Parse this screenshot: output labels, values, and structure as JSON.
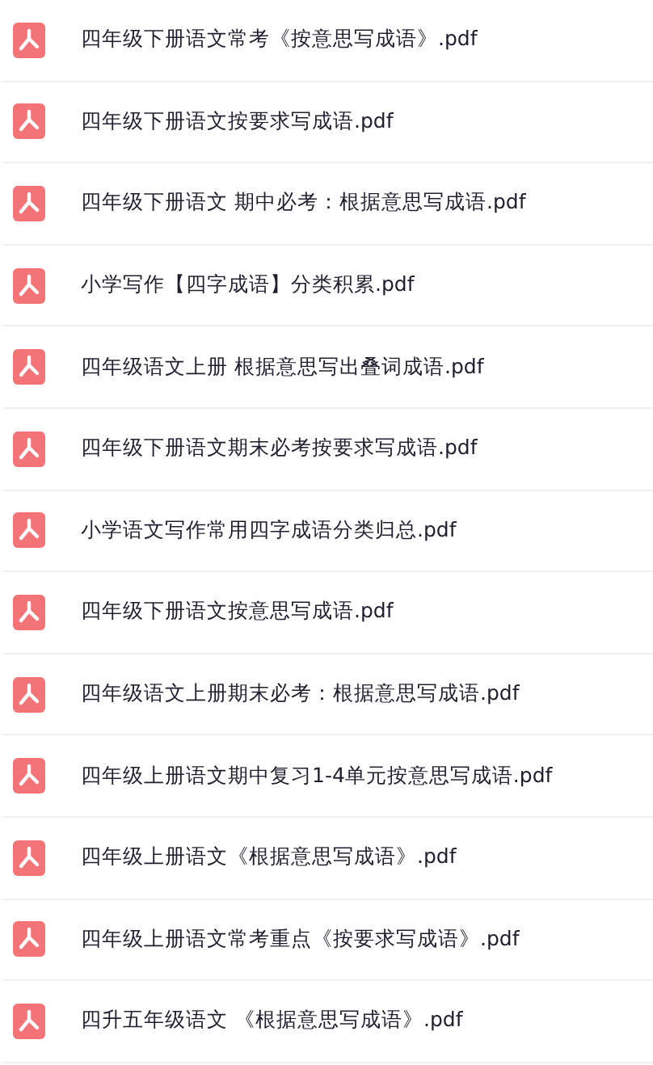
{
  "files": [
    {
      "name": "四年级下册语文常考《按意思写成语》.pdf",
      "kind": "pdf"
    },
    {
      "name": "四年级下册语文按要求写成语.pdf",
      "kind": "pdf"
    },
    {
      "name": "四年级下册语文 期中必考：根据意思写成语.pdf",
      "kind": "pdf"
    },
    {
      "name": "小学写作【四字成语】分类积累.pdf",
      "kind": "pdf"
    },
    {
      "name": "四年级语文上册 根据意思写出叠词成语.pdf",
      "kind": "pdf"
    },
    {
      "name": "四年级下册语文期末必考按要求写成语.pdf",
      "kind": "pdf"
    },
    {
      "name": "小学语文写作常用四字成语分类归总.pdf",
      "kind": "pdf"
    },
    {
      "name": "四年级下册语文按意思写成语.pdf",
      "kind": "pdf"
    },
    {
      "name": "四年级语文上册期末必考：根据意思写成语.pdf",
      "kind": "pdf"
    },
    {
      "name": "四年级上册语文期中复习1-4单元按意思写成语.pdf",
      "kind": "pdf"
    },
    {
      "name": "四年级上册语文《根据意思写成语》.pdf",
      "kind": "pdf"
    },
    {
      "name": "四年级上册语文常考重点《按要求写成语》.pdf",
      "kind": "pdf"
    },
    {
      "name": "四升五年级语文 《根据意思写成语》.pdf",
      "kind": "pdf"
    }
  ]
}
